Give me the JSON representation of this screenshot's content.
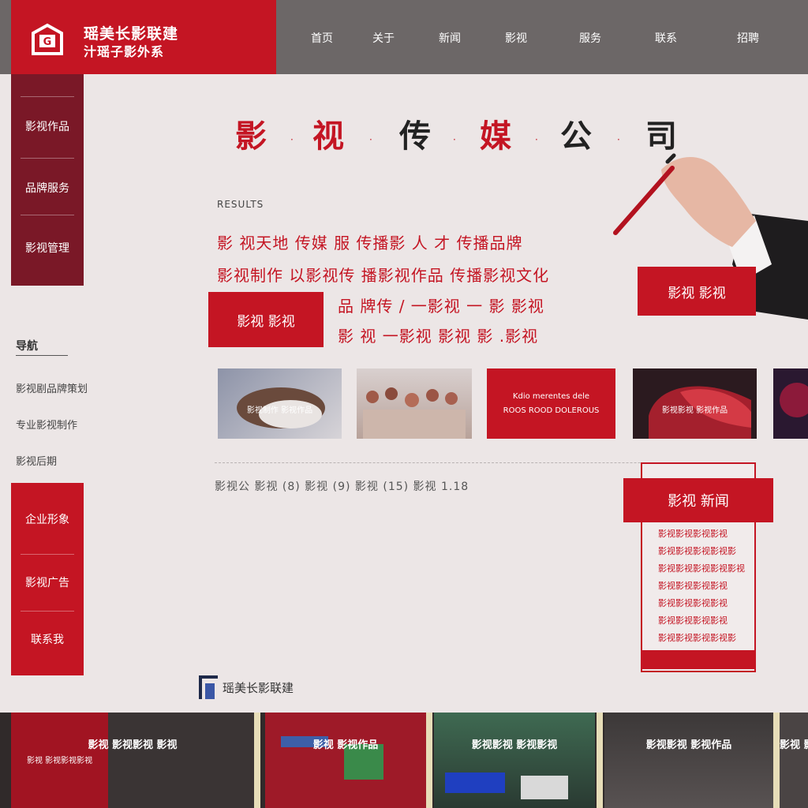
{
  "header": {
    "logo_line1": "瑶美长影联建",
    "logo_line2": "汁瑶子影外系",
    "nav": [
      "首页",
      "关于",
      "新闻",
      "影视",
      "服务",
      "联系",
      "招聘"
    ]
  },
  "sidebar": {
    "top_items": [
      "影视作品",
      "品牌服务",
      "影视管理"
    ],
    "heading": "导航",
    "links": [
      "影视剧品牌策划",
      "专业影视制作",
      "影视后期"
    ],
    "bottom_items": [
      "企业形象",
      "影视广告",
      "联系我"
    ]
  },
  "hero": {
    "title_chars": [
      "影",
      "视",
      "传",
      "媒",
      "公",
      "司"
    ],
    "results_label": "RESULTS",
    "line1": "影 视天地 传媒 服 传播影 人 才 传播品牌",
    "line2": "影视制作 以影视传 播影视作品 传播影视文化",
    "line3": "品 牌传 / 一影视 一 影 影视",
    "line4": "影 视 一影视 影视 影 .影视",
    "button_left": "影视 影视",
    "button_right": "影视 影视"
  },
  "thumbnails": [
    {
      "caption": "影视制作 影视作品"
    },
    {
      "caption": ""
    },
    {
      "caption_line1": "Kdio merentes dele",
      "caption_line2": "ROOS ROOD DOLEROUS"
    },
    {
      "caption": "影视影视 影视作品"
    },
    {
      "caption": ""
    }
  ],
  "stats_line": "影视公 影视 (8) 影视 (9) 影视 (15) 影视 1.18",
  "news": {
    "header": "影视 新闻",
    "items": [
      "影视影视影视影视",
      "影视影视影视影视影",
      "影视影视影视影视影视",
      "影视影视影视影视",
      "影视影视影视影视",
      "影视影视影视影视",
      "影视影视影视影视影"
    ]
  },
  "footer_logo_text": "瑶美长影联建",
  "gallery": [
    {
      "caption": "影视 影视影视 影视",
      "sub": "影视 影视影视影视"
    },
    {
      "caption": "影视 影视作品",
      "sub": ""
    },
    {
      "caption": "影视影视 影视影视",
      "sub": ""
    },
    {
      "caption": "影视影视 影视作品",
      "sub": ""
    },
    {
      "caption": "影视 影视",
      "sub": ""
    }
  ],
  "colors": {
    "brand_red": "#c41523",
    "dark_red": "#7a1827",
    "nav_gray": "#6c6767",
    "page_bg": "#ece6e6"
  }
}
